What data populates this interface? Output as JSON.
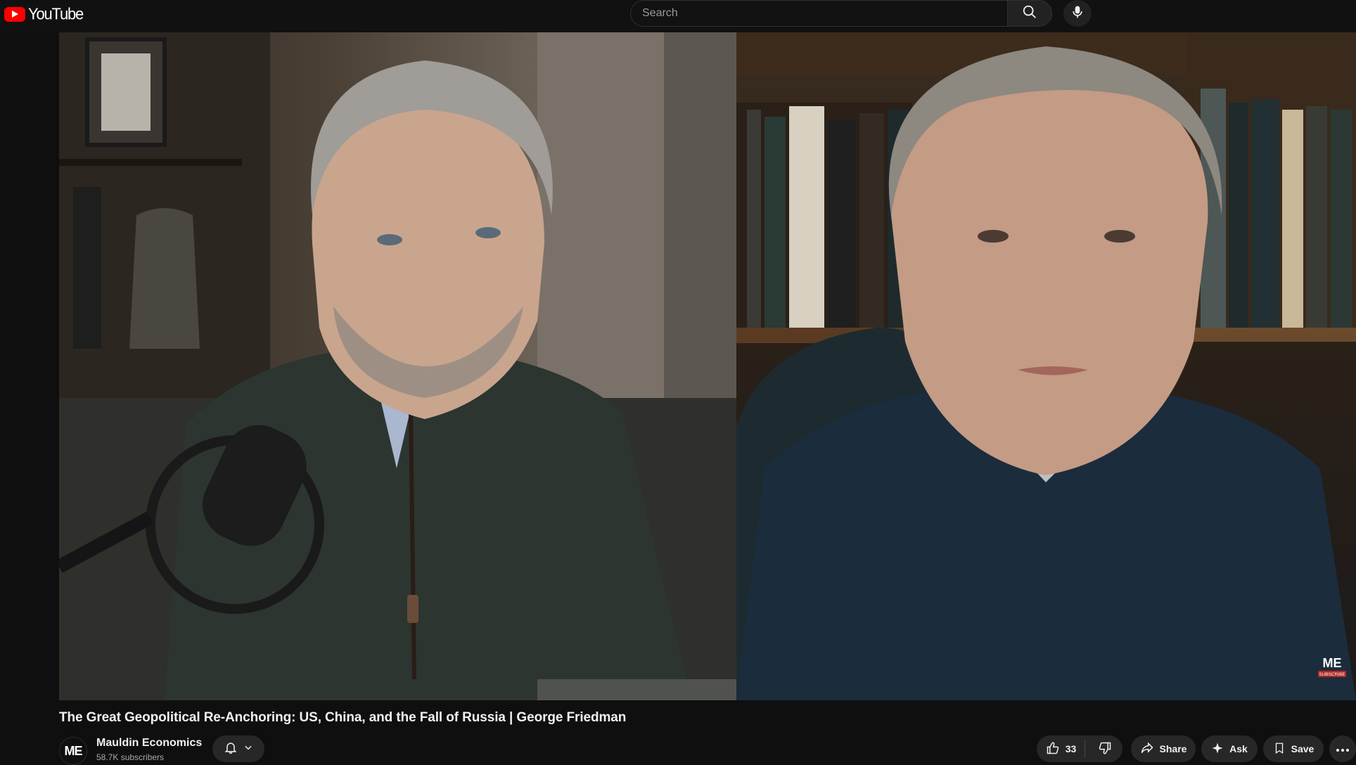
{
  "header": {
    "logo_text": "YouTube",
    "search_placeholder": "Search",
    "icons": [
      "youtube-logo-icon",
      "search-icon",
      "microphone-icon"
    ]
  },
  "video": {
    "watermark": "ME",
    "watermark_sub": "SUBSCRIBE",
    "title": "The Great Geopolitical Re-Anchoring: US, China, and the Fall of Russia | George Friedman"
  },
  "channel": {
    "avatar_text": "ME",
    "name": "Mauldin Economics",
    "subscribers": "58.7K subscribers"
  },
  "actions": {
    "like_count": "33",
    "share_label": "Share",
    "ask_label": "Ask",
    "save_label": "Save"
  },
  "colors": {
    "background": "#0f0f0f",
    "brand_red": "#ff0000",
    "pill_bg": "#272727"
  }
}
